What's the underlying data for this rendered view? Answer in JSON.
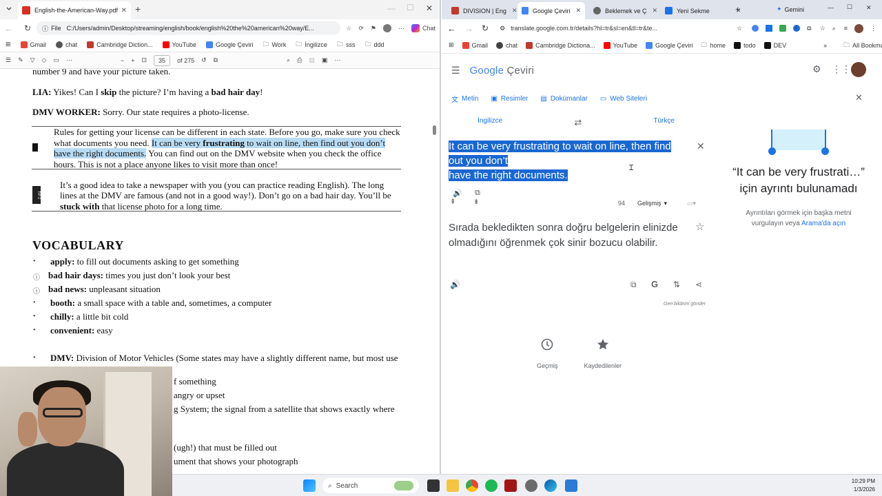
{
  "left": {
    "tab_title": "English-the-American-Way.pdf",
    "file_label": "File",
    "url": "C:/Users/admin/Desktop/streaming/english/book/english%20the%20american%20way/E...",
    "copilot_label": "Chat",
    "bookmarks": [
      "Gmail",
      "chat",
      "Cambridge Diction...",
      "YouTube",
      "Google Çeviri",
      "Work",
      "İngilizce",
      "sss",
      "ddd"
    ],
    "pdf_page": "35",
    "pdf_total": "of 275",
    "pdf_lines": {
      "l0": "number 9 and have your picture taken.",
      "l1_a": "LIA:",
      "l1_b": " Yikes! Can I ",
      "l1_c": "skip",
      "l1_d": " the picture? I’m having a ",
      "l1_e": "bad hair day",
      "l1_f": "!",
      "l2_a": "DMV WORKER:",
      "l2_b": " Sorry. Our state requires a photo-license.",
      "t1_1": "Rules for getting your license can be different in each state. Before you go, make sure you check",
      "t1_2a": "what documents you need. ",
      "t1_2b": "It can be very ",
      "t1_2c": "frustrating",
      "t1_2d": " to wait on line, then find out you don’t",
      "t1_3a": "have the right documents.",
      "t1_3b": " You can find out on the DMV website when you check the office",
      "t1_4": "hours. This is not a place anyone likes to visit more than once!",
      "t2_1": "It’s a good idea to take a newspaper with you (you can practice reading English). The long",
      "t2_2": "lines at the DMV are famous (and not in a good way!). Don’t go on a bad hair day. You’ll be",
      "t2_3a": "stuck with",
      "t2_3b": " that license photo for a long time.",
      "tip_label": "TIP 2",
      "vocab_title": "VOCABULARY",
      "v1a": "apply:",
      "v1b": " to fill out documents asking to get something",
      "v2a": "bad hair days:",
      "v2b": " times you just don’t look your best",
      "v3a": "bad news:",
      "v3b": " unpleasant situation",
      "v4a": "booth:",
      "v4b": " a small space with a table and, sometimes, a computer",
      "v5a": "chilly:",
      "v5b": " a little bit cold",
      "v6a": "convenient:",
      "v6b": " easy",
      "v7a": "DMV:",
      "v7b": " Division of Motor Vehicles (Some states may have a slightly different name, but most use",
      "v8": "f something",
      "v9": "angry or upset",
      "v10": "g System; the signal from a satellite that shows exactly where",
      "v11": "(ugh!) that must be filled out",
      "v12": "ument that shows your photograph"
    }
  },
  "right": {
    "tabs": [
      "DIVISION | Eng",
      "Google Çeviri",
      "Beklemek ve Ç",
      "Yeni Sekme"
    ],
    "gemini_label": "Gemini",
    "url": "translate.google.com.tr/details?hl=tr&sl=en&tl=tr&te...",
    "bookmarks": [
      "Gmail",
      "chat",
      "Cambridge Dictiona...",
      "YouTube",
      "Google Çeviri",
      "home",
      "todo",
      "DEV"
    ],
    "all_bookmarks": "All Bookmarks",
    "logo_google": "Google",
    "logo_ceviri": "Çeviri",
    "modes": [
      "Metin",
      "Resimler",
      "Dokümanlar",
      "Web Siteleri"
    ],
    "source_lang": "İngilizce",
    "target_lang": "Türkçe",
    "source_text_1": "It can be very frustrating to wait on line, then find",
    "source_text_2": "out you don’t",
    "source_text_3": "have the right documents.",
    "char_count": "94",
    "model_label": "Gelişmiş",
    "translation": "Sırada bekledikten sonra doğru belgelerin elinizde olmadığını öğrenmek çok sinir bozucu olabilir.",
    "feedback": "Geri bildirim gönder",
    "history": "Geçmiş",
    "saved": "Kaydedilenler",
    "side_quote_1": "“It can be very frustrati…”",
    "side_quote_2": "için ayrıntı bulunamadı",
    "side_sub_1": "Ayrıntıları görmek için başka metni",
    "side_sub_2": "vurgulayın veya",
    "side_link": "Arama'da açın"
  },
  "taskbar": {
    "search": "Search",
    "time": "10:29 PM",
    "date": "1/3/2026"
  }
}
